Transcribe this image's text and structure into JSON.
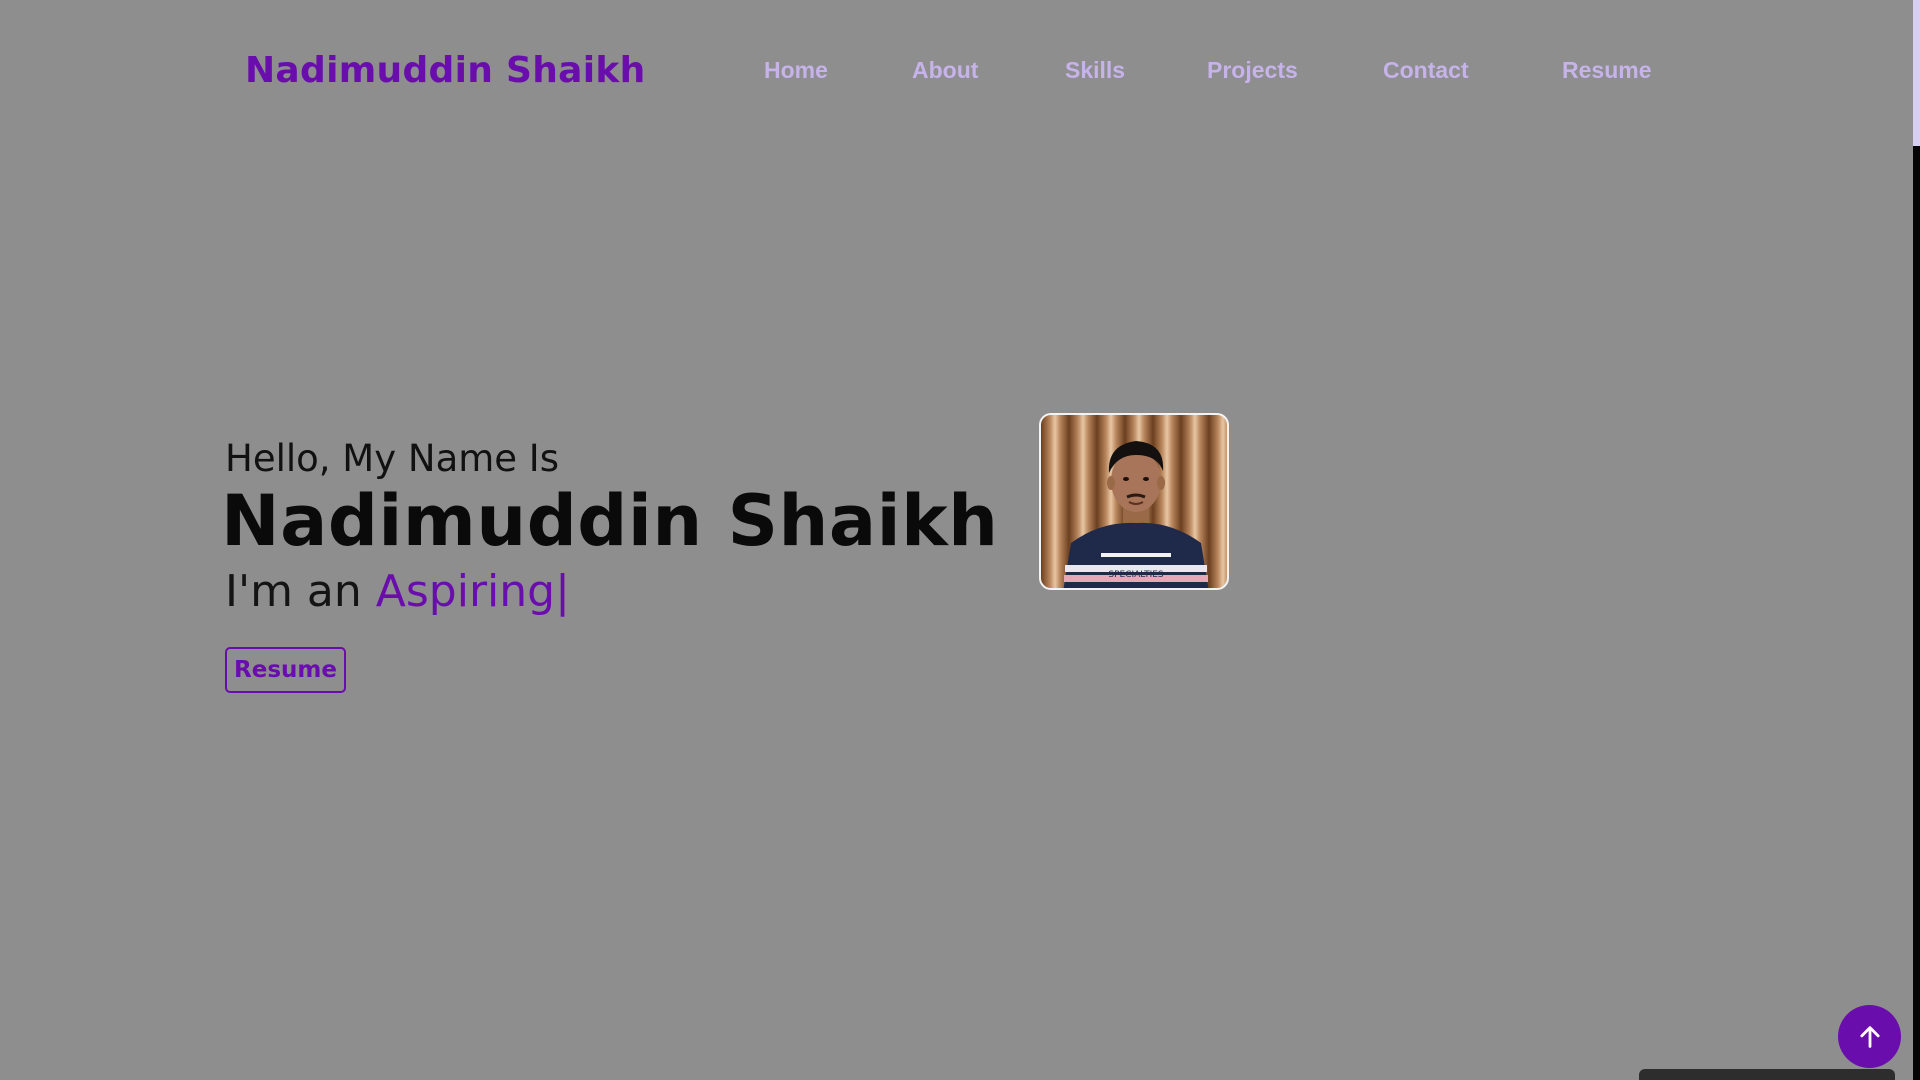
{
  "header": {
    "logo": "Nadimuddin Shaikh",
    "nav": [
      {
        "label": "Home"
      },
      {
        "label": "About"
      },
      {
        "label": "Skills"
      },
      {
        "label": "Projects"
      },
      {
        "label": "Contact"
      },
      {
        "label": "Resume"
      }
    ]
  },
  "hero": {
    "greeting": "Hello, My Name Is",
    "name": "Nadimuddin Shaikh",
    "role_prefix": "I'm an ",
    "role_typed": "Aspiring",
    "caret": "|",
    "resume_button": "Resume"
  },
  "photo": {
    "shirt_text": "SPECIALTIES"
  },
  "back_to_top": {
    "icon": "arrow-up-icon"
  },
  "colors": {
    "accent": "#6a0dad",
    "nav": "#c5b3ea",
    "background": "#8e8e8e"
  }
}
